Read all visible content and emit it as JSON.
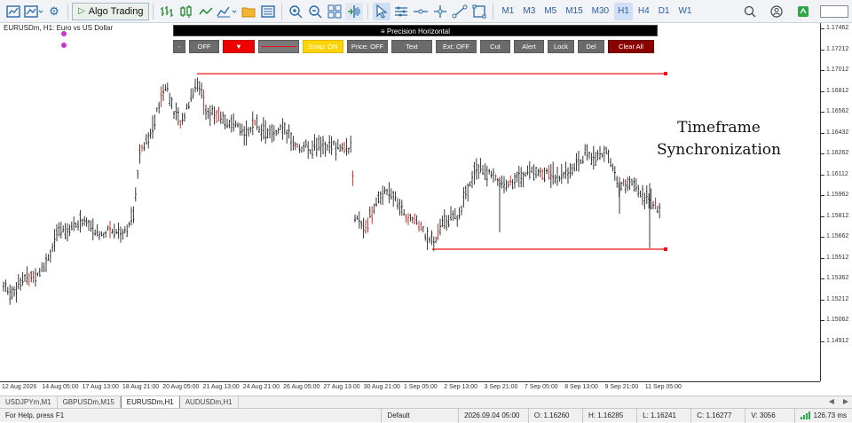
{
  "toolbar": {
    "algo_trading_label": "Algo Trading",
    "timeframes": [
      {
        "label": "M1",
        "active": false
      },
      {
        "label": "M3",
        "active": false
      },
      {
        "label": "M5",
        "active": false
      },
      {
        "label": "M15",
        "active": false
      },
      {
        "label": "M30",
        "active": false
      },
      {
        "label": "H1",
        "active": true
      },
      {
        "label": "H4",
        "active": false
      },
      {
        "label": "D1",
        "active": false
      },
      {
        "label": "W1",
        "active": false
      }
    ]
  },
  "chart": {
    "symbol_label": "EURUSDm, H1:  Euro vs US Dollar",
    "overlay_title_line1": "Timeframe",
    "overlay_title_line2": "Synchronization",
    "price_labels": [
      "1.17462",
      "1.17212",
      "1.17012",
      "1.16812",
      "1.16562",
      "1.16432",
      "1.16262",
      "1.16112",
      "1.15962",
      "1.15812",
      "1.15662",
      "1.15512",
      "1.15362",
      "1.15212",
      "1.15062",
      "1.14912"
    ],
    "time_labels": [
      "12 Aug 2026",
      "14 Aug 05:00",
      "17 Aug 13:00",
      "18 Aug 21:00",
      "20 Aug 05:00",
      "21 Aug 13:00",
      "24 Aug 21:00",
      "26 Aug 05:00",
      "27 Aug 13:00",
      "30 Aug 21:00",
      "1 Sep 05:00",
      "2 Sep 13:00",
      "3 Sep 21:00",
      "7 Sep 05:00",
      "8 Sep 13:00",
      "9 Sep 21:00",
      "11 Sep 05:00"
    ],
    "upper_level_price": 1.17092,
    "lower_level_price": 1.15661,
    "line_color": "#ee1111"
  },
  "precision_panel": {
    "title": "≡  Precision Horizontal",
    "buttons": [
      {
        "label": "-",
        "style": "gray"
      },
      {
        "label": "OFF",
        "style": "gray"
      },
      {
        "label": "▼",
        "style": "red"
      },
      {
        "label": "",
        "style": "line"
      },
      {
        "label": "Snap: ON",
        "style": "yellow"
      },
      {
        "label": "Price: OFF",
        "style": "gray"
      },
      {
        "label": "Text",
        "style": "gray"
      },
      {
        "label": "Ext: OFF",
        "style": "gray"
      },
      {
        "label": "Cut",
        "style": "gray"
      },
      {
        "label": "Alert",
        "style": "gray"
      },
      {
        "label": "Lock",
        "style": "gray"
      },
      {
        "label": "Del",
        "style": "gray"
      },
      {
        "label": "Clear All",
        "style": "dark"
      }
    ]
  },
  "tabs": [
    {
      "label": "USDJPYm,M1",
      "active": false
    },
    {
      "label": "GBPUSDm,M15",
      "active": false
    },
    {
      "label": "EURUSDm,H1",
      "active": true
    },
    {
      "label": "AUDUSDm,H1",
      "active": false
    }
  ],
  "status": {
    "help": "For Help, press F1",
    "profile": "Default",
    "time": "2026.09.04 05:00",
    "open": "O: 1.16260",
    "high": "H: 1.16285",
    "low": "L: 1.16241",
    "close": "C: 1.16277",
    "volume": "V: 3056",
    "network": "126.73 ms"
  },
  "colors": {
    "accent": "#2a6aa8",
    "bullish": "#222222",
    "bearish": "#cc2222",
    "snap_on": "#ffd400",
    "clear_all": "#8b0000"
  }
}
